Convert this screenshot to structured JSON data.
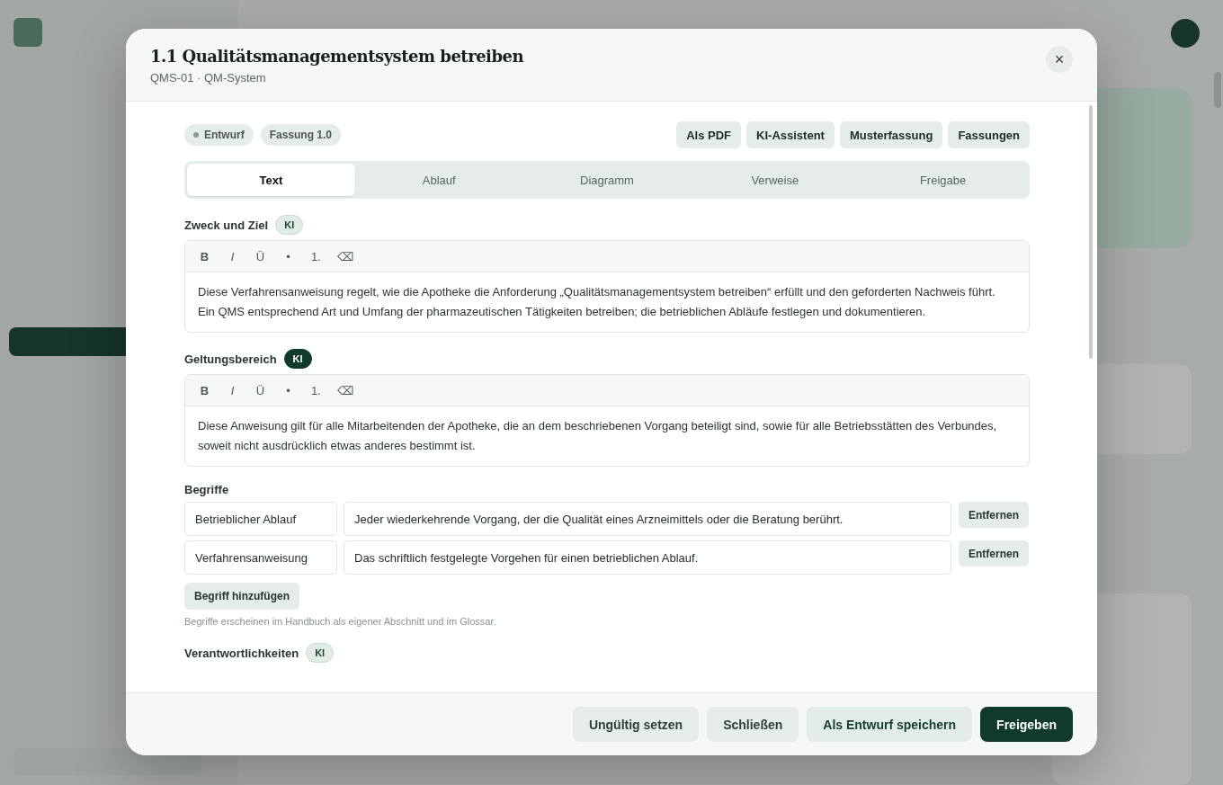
{
  "dialog": {
    "title": "1.1 Qualitätsmanagementsystem betreiben",
    "subtitle": "QMS-01 · QM-System",
    "close_label": "×"
  },
  "chips": [
    {
      "label": "Entwurf",
      "kind": "status"
    },
    {
      "label": "Fassung 1.0",
      "kind": "plain"
    }
  ],
  "actions": [
    "Als PDF",
    "KI-Assistent",
    "Musterfassung",
    "Fassungen"
  ],
  "tabs": [
    {
      "label": "Text",
      "selected": true
    },
    {
      "label": "Ablauf",
      "selected": false
    },
    {
      "label": "Diagramm",
      "selected": false
    },
    {
      "label": "Verweise",
      "selected": false
    },
    {
      "label": "Freigabe",
      "selected": false
    }
  ],
  "sections": [
    {
      "kind": "editor",
      "label": "Zweck und Ziel",
      "ki": {
        "label": "KI",
        "active": false
      },
      "toolbar": [
        "B",
        "I",
        "Ü",
        "•",
        "1.",
        "⌫"
      ],
      "text": [
        "Diese Verfahrensanweisung regelt, wie die Apotheke die Anforderung „Qualitätsmanagementsystem betreiben“ erfüllt und den geforderten Nachweis führt.",
        "Ein QMS entsprechend Art und Umfang der pharmazeutischen Tätigkeiten betreiben; die betrieblichen Abläufe festlegen und dokumentieren."
      ]
    },
    {
      "kind": "editor",
      "label": "Geltungsbereich",
      "ki": {
        "label": "KI",
        "active": true
      },
      "toolbar": [
        "B",
        "I",
        "Ü",
        "•",
        "1.",
        "⌫"
      ],
      "text": [
        "Diese Anweisung gilt für alle Mitarbeitenden der Apotheke, die an dem beschriebenen Vorgang beteiligt sind, sowie für alle Betriebsstätten des Verbundes,",
        "soweit nicht ausdrücklich etwas anderes bestimmt ist."
      ]
    },
    {
      "kind": "terms",
      "label": "Begriffe",
      "terms": [
        {
          "term": "Betrieblicher Ablauf",
          "definition": "Jeder wiederkehrende Vorgang, der die Qualität eines Arzneimittels oder die Beratung berührt.",
          "remove": "Entfernen"
        },
        {
          "term": "Verfahrensanweisung",
          "definition": "Das schriftlich festgelegte Vorgehen für einen betrieblichen Ablauf.",
          "remove": "Entfernen"
        }
      ],
      "add": "Begriff hinzufügen",
      "hint": "Begriffe erscheinen im Handbuch als eigener Abschnitt und im Glossar."
    },
    {
      "kind": "heading",
      "label": "Verantwortlichkeiten",
      "ki": {
        "label": "KI",
        "active": false
      }
    }
  ],
  "footer": [
    {
      "label": "Ungültig setzen",
      "kind": "secondary"
    },
    {
      "label": "Schließen",
      "kind": "secondary"
    },
    {
      "label": "Als Entwurf speichern",
      "kind": "soft"
    },
    {
      "label": "Freigeben",
      "kind": "primary"
    }
  ]
}
